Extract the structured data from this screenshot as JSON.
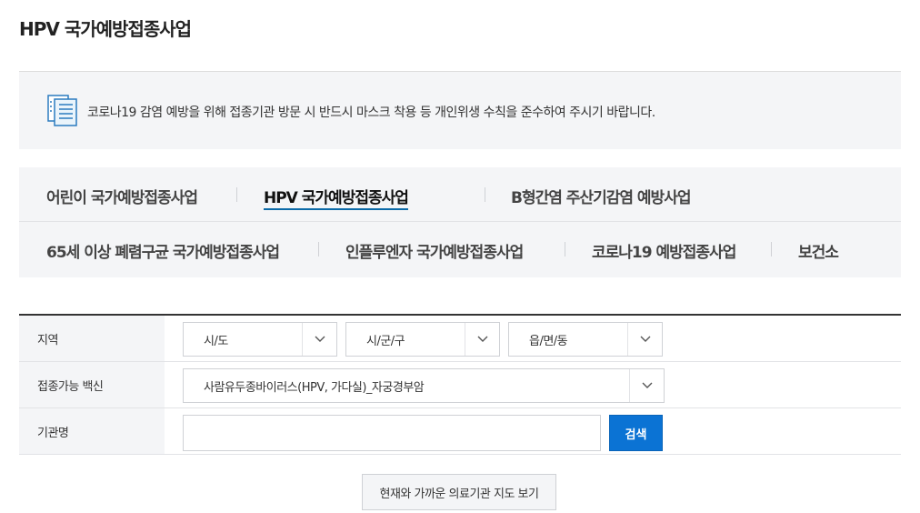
{
  "page": {
    "title": "HPV 국가예방접종사업"
  },
  "notice": {
    "icon": "document-list-icon",
    "text": "코로나19 감염 예방을 위해 접종기관 방문 시 반드시 마스크 착용 등 개인위생 수칙을 준수하여 주시기 바랍니다."
  },
  "tabs": {
    "row1": [
      {
        "label": "어린이 국가예방접종사업"
      },
      {
        "label": "HPV 국가예방접종사업",
        "active": true
      },
      {
        "label": "B형간염 주산기감염 예방사업"
      }
    ],
    "row2": [
      {
        "label": "65세 이상 폐렴구균 국가예방접종사업"
      },
      {
        "label": "인플루엔자 국가예방접종사업"
      },
      {
        "label": "코로나19 예방접종사업"
      },
      {
        "label": "보건소"
      }
    ]
  },
  "form": {
    "region": {
      "label": "지역",
      "sido": "시/도",
      "sigungu": "시/군/구",
      "eupmyeondong": "읍/면/동"
    },
    "vaccine": {
      "label": "접종가능 백신",
      "value": "사람유두종바이러스(HPV, 가다실)_자궁경부암"
    },
    "institution": {
      "label": "기관명",
      "value": "",
      "placeholder": "",
      "search_label": "검색"
    }
  },
  "map_button": {
    "label": "현재와 가까운 의료기관 지도 보기"
  },
  "colors": {
    "accent": "#0b73d4",
    "tab_underline": "#0b6aa8",
    "panel_bg": "#f4f5f7"
  }
}
